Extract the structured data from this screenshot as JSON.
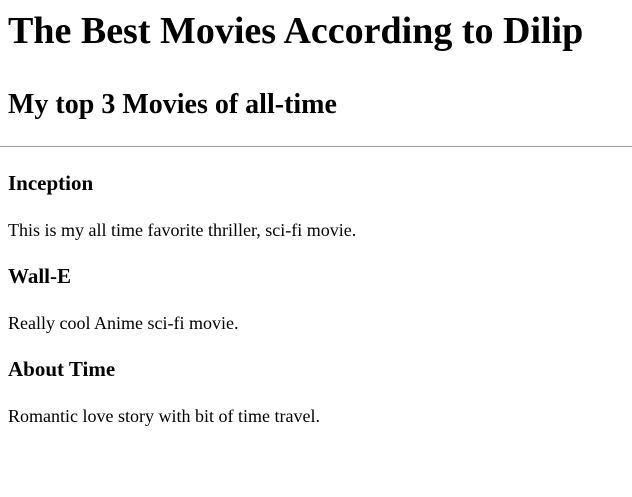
{
  "page": {
    "title": "The Best Movies According to Dilip",
    "subtitle": "My top 3 Movies of all-time"
  },
  "movies": [
    {
      "name": "Inception",
      "description": "This is my all time favorite thriller, sci-fi movie."
    },
    {
      "name": "Wall-E",
      "description": "Really cool Anime sci-fi movie."
    },
    {
      "name": "About Time",
      "description": "Romantic love story with bit of time travel."
    }
  ]
}
